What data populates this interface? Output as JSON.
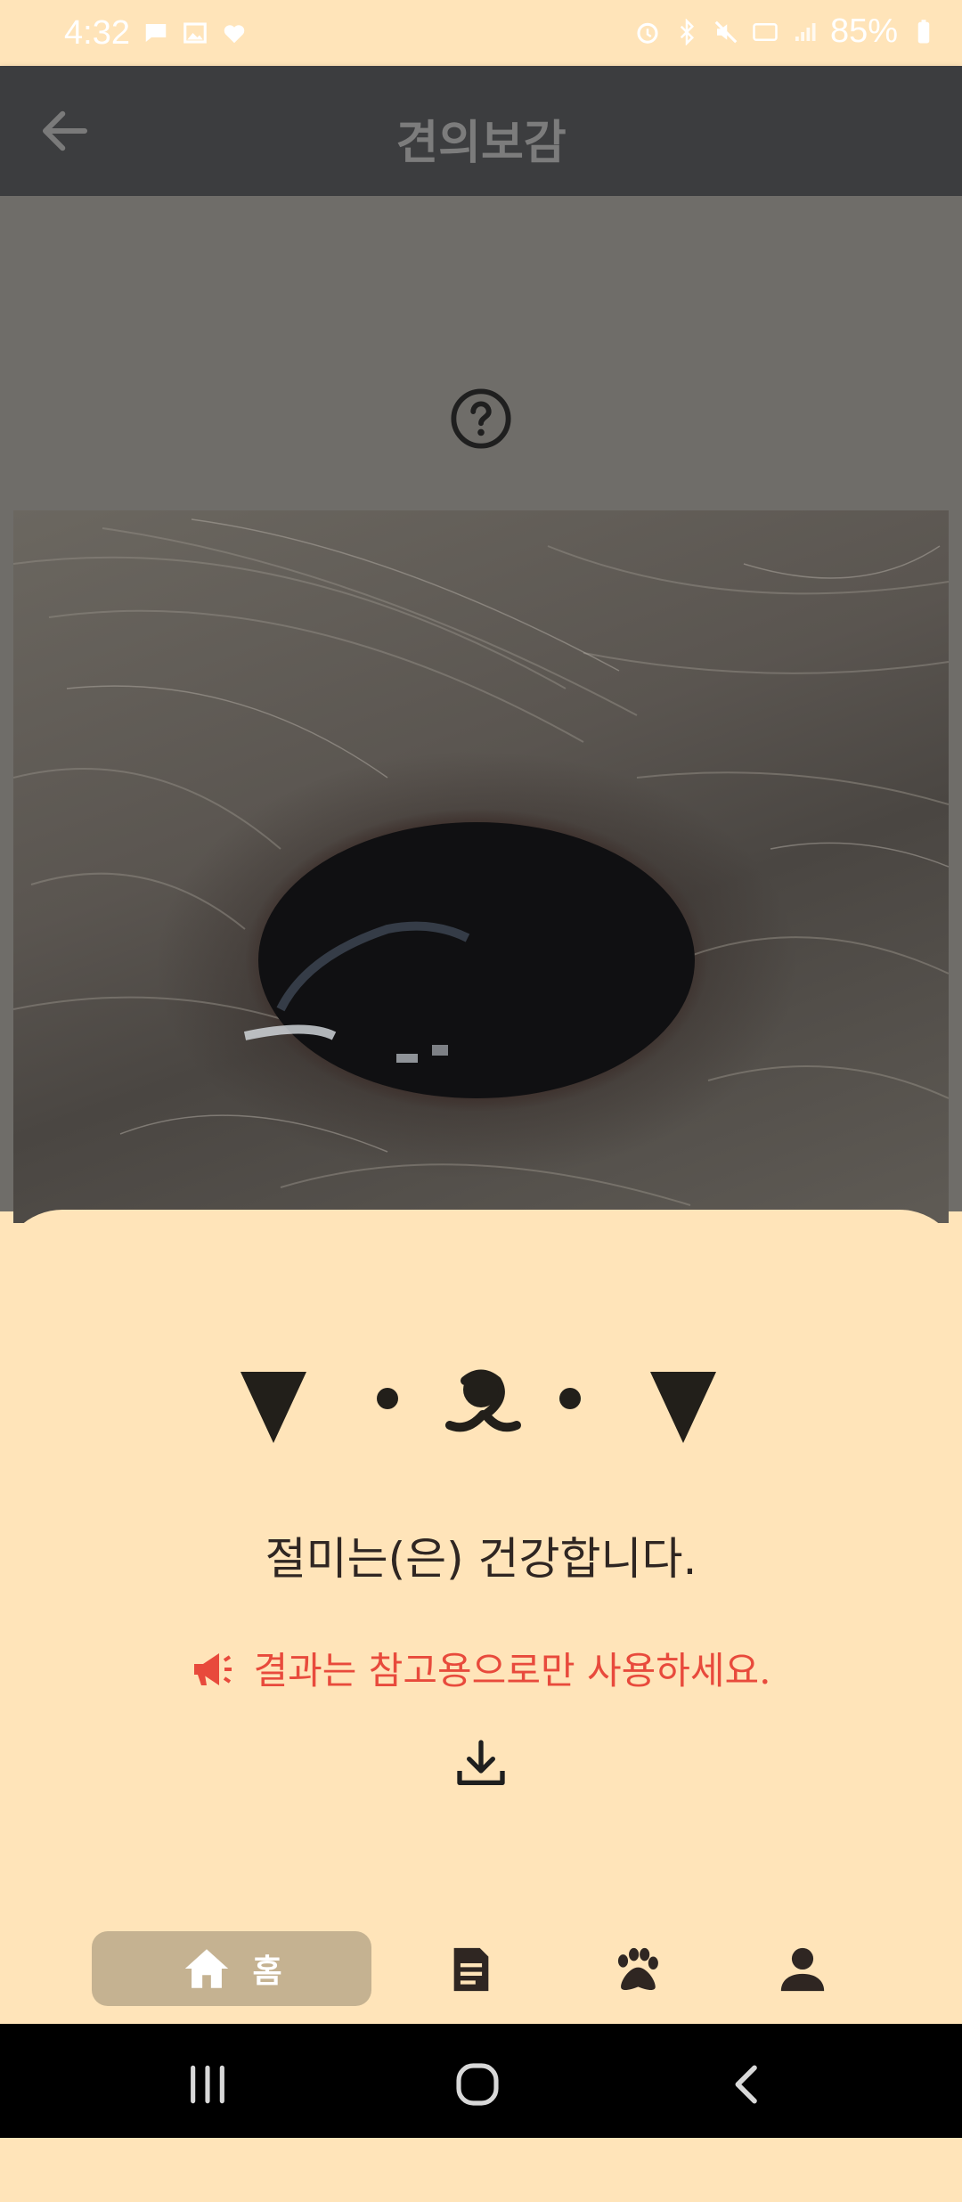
{
  "status_bar": {
    "time": "4:32",
    "battery": "85%",
    "left_icons": [
      "chat-icon",
      "gallery-icon",
      "heart-icon"
    ],
    "right_icons": [
      "alarm-icon",
      "bluetooth-icon",
      "mute-icon",
      "5g-icon",
      "signal-icon",
      "battery-icon"
    ]
  },
  "app_bar": {
    "title": "견의보감",
    "back_icon": "arrow-left-icon"
  },
  "help_icon": "question-circle-icon",
  "result": {
    "face_icon": "dog-face-icon",
    "message": "절미는(은) 건강합니다.",
    "notice": "결과는 참고용으로만 사용하세요.",
    "notice_icon": "megaphone-icon",
    "download_icon": "download-icon"
  },
  "bottom_nav": {
    "items": [
      {
        "icon": "home-icon",
        "label": "홈",
        "active": true
      },
      {
        "icon": "document-icon",
        "label": ""
      },
      {
        "icon": "paw-icon",
        "label": ""
      },
      {
        "icon": "person-icon",
        "label": ""
      }
    ]
  },
  "colors": {
    "background": "#ffe4b9",
    "appbar": "#3c3d3f",
    "accent_red": "#e84a3c",
    "nav_active": "#c5b291",
    "text_dark": "#2f2622"
  }
}
